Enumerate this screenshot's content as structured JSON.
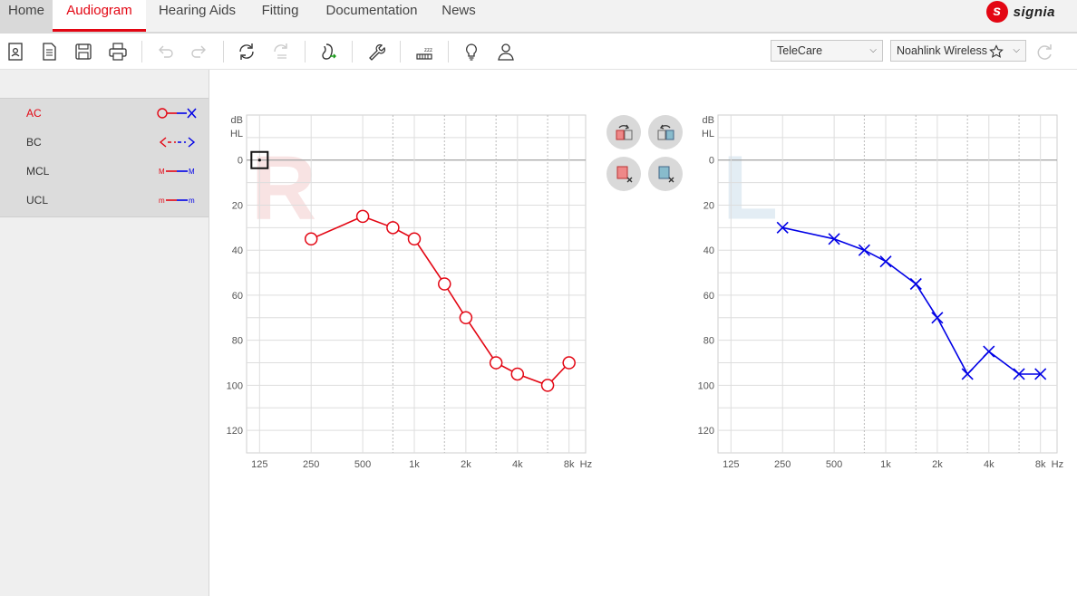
{
  "nav": {
    "tabs": [
      "Home",
      "Audiogram",
      "Hearing Aids",
      "Fitting",
      "Documentation",
      "News"
    ],
    "active": "Audiogram",
    "brand": "signia",
    "brand_logo_letter": "s"
  },
  "toolbar": {
    "icons": [
      "client-icon",
      "document-icon",
      "save-icon",
      "print-icon",
      "undo-icon",
      "redo-icon",
      "transfer-icon",
      "transfer-disabled-icon",
      "hearing-aid-connect-icon",
      "wrench-icon",
      "sleep-mode-icon",
      "lightbulb-icon",
      "person-icon"
    ],
    "program_select": "TeleCare",
    "device_select": "Noahlink Wireless"
  },
  "legend": {
    "items": [
      {
        "label": "AC",
        "active": true
      },
      {
        "label": "BC",
        "active": false
      },
      {
        "label": "MCL",
        "active": false
      },
      {
        "label": "UCL",
        "active": false
      }
    ]
  },
  "chart_data": [
    {
      "type": "line",
      "ear": "R",
      "ylabel_line1": "dB",
      "ylabel_line2": "HL",
      "xunit": "Hz",
      "x_tick_labels": [
        "125",
        "250",
        "500",
        "1k",
        "2k",
        "4k",
        "8k"
      ],
      "y_tick_labels": [
        "0",
        "20",
        "40",
        "60",
        "80",
        "100",
        "120"
      ],
      "ylim": [
        -20,
        130
      ],
      "color": "#e30613",
      "marker": "circle",
      "points": [
        {
          "freq": 250,
          "db": 35
        },
        {
          "freq": 500,
          "db": 25
        },
        {
          "freq": 750,
          "db": 30
        },
        {
          "freq": 1000,
          "db": 35
        },
        {
          "freq": 1500,
          "db": 55
        },
        {
          "freq": 2000,
          "db": 70
        },
        {
          "freq": 3000,
          "db": 90
        },
        {
          "freq": 4000,
          "db": 95
        },
        {
          "freq": 6000,
          "db": 100
        },
        {
          "freq": 8000,
          "db": 90
        }
      ],
      "cursor": {
        "freq": 125,
        "db": 0
      }
    },
    {
      "type": "line",
      "ear": "L",
      "ylabel_line1": "dB",
      "ylabel_line2": "HL",
      "xunit": "Hz",
      "x_tick_labels": [
        "125",
        "250",
        "500",
        "1k",
        "2k",
        "4k",
        "8k"
      ],
      "y_tick_labels": [
        "0",
        "20",
        "40",
        "60",
        "80",
        "100",
        "120"
      ],
      "ylim": [
        -20,
        130
      ],
      "color": "#0000e6",
      "marker": "x",
      "points": [
        {
          "freq": 250,
          "db": 30
        },
        {
          "freq": 500,
          "db": 35
        },
        {
          "freq": 750,
          "db": 40
        },
        {
          "freq": 1000,
          "db": 45
        },
        {
          "freq": 1500,
          "db": 55
        },
        {
          "freq": 2000,
          "db": 70
        },
        {
          "freq": 3000,
          "db": 95
        },
        {
          "freq": 4000,
          "db": 85
        },
        {
          "freq": 6000,
          "db": 95
        },
        {
          "freq": 8000,
          "db": 95
        }
      ]
    }
  ]
}
